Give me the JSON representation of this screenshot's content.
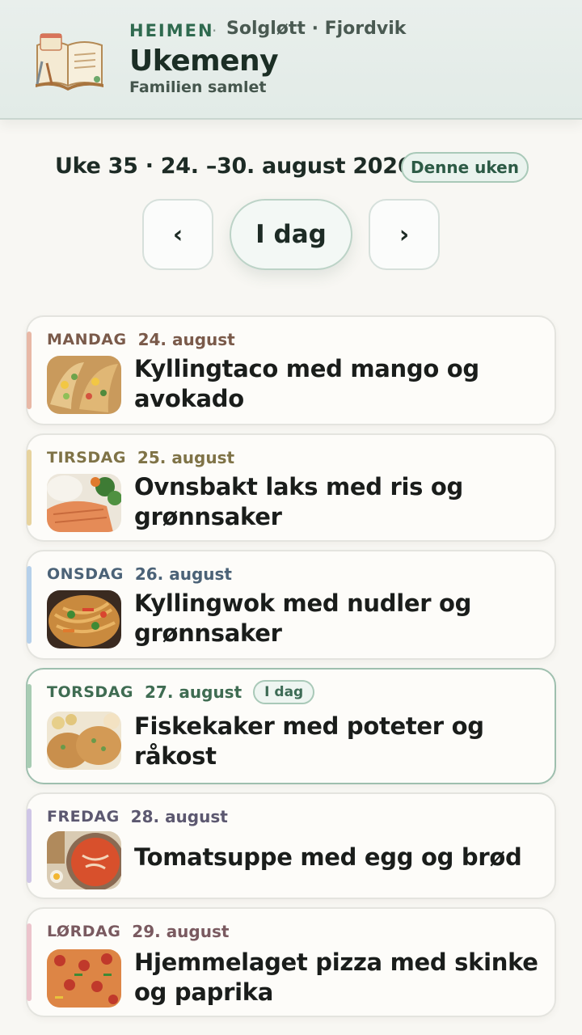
{
  "header": {
    "brand": "HEIMEN",
    "separator": "·",
    "location": "Solgløtt · Fjordvik",
    "title": "Ukemeny",
    "subtitle": "Familien samlet",
    "logo_icon": "recipe-book-icon"
  },
  "week": {
    "label": "Uke 35 · 24. –30. august 2026",
    "badge": "Denne uken"
  },
  "nav": {
    "prev": "‹",
    "today": "I dag",
    "next": "›"
  },
  "days": [
    {
      "name": "MANDAG",
      "date": "24. august",
      "meal": "Kyllingtaco med mango og avokado",
      "color": "#e8b8a6",
      "name_color": "#7a5a4a"
    },
    {
      "name": "TIRSDAG",
      "date": "25. august",
      "meal": "Ovnsbakt laks med ris og grønnsaker",
      "color": "#e7d39e",
      "name_color": "#7f7347"
    },
    {
      "name": "ONSDAG",
      "date": "26. august",
      "meal": "Kyllingwok med nudler og grønnsaker",
      "color": "#b6d0ea",
      "name_color": "#4b6277"
    },
    {
      "name": "TORSDAG",
      "date": "27. august",
      "today_badge": "I dag",
      "meal": "Fiskekaker med poteter og råkost",
      "color": "#a8ccb3",
      "name_color": "#3f6c52"
    },
    {
      "name": "FREDAG",
      "date": "28. august",
      "meal": "Tomatsuppe med egg og brød",
      "color": "#cfc6e6",
      "name_color": "#5c5870"
    },
    {
      "name": "LØRDAG",
      "date": "29. august",
      "meal": "Hjemmelaget pizza med skinke og paprika",
      "color": "#ecc4cc",
      "name_color": "#7a5a60"
    }
  ]
}
